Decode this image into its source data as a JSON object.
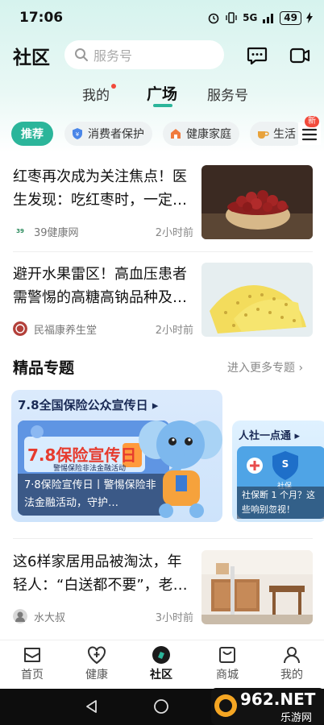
{
  "status_bar": {
    "time": "17:06",
    "signal": "5G",
    "battery": "49"
  },
  "header": {
    "title": "社区",
    "search_placeholder": "服务号"
  },
  "tabs": [
    {
      "label": "我的"
    },
    {
      "label": "广场"
    },
    {
      "label": "服务号"
    }
  ],
  "chips": [
    {
      "label": "推荐"
    },
    {
      "label": "消费者保护"
    },
    {
      "label": "健康家庭"
    },
    {
      "label": "生活"
    }
  ],
  "new_badge": "新",
  "articles": [
    {
      "title": "红枣再次成为关注焦点！医生发现：吃红枣时，一定…",
      "source": "39健康网",
      "time": "2小时前"
    },
    {
      "title": "避开水果雷区！高血压患者需警惕的高糖高钠品种及…",
      "source": "民福康养生堂",
      "time": "2小时前"
    },
    {
      "title": "这6样家居用品被淘汰，年轻人：“白送都不要”，老…",
      "source": "水大叔",
      "time": "3小时前"
    }
  ],
  "topics": {
    "title": "精品专题",
    "more": "进入更多专题",
    "cards": [
      {
        "heading": "7.8全国保险公众宣传日",
        "poster_text": "7.8保险宣传日",
        "poster_sub": "警惕保险非法金融活动",
        "caption": "7·8保险宣传日丨警惕保险非法金融活动，守护…"
      },
      {
        "heading": "人社一点通",
        "badge": "社保",
        "caption": "社保断 1 个月？这些响别忽视！"
      }
    ]
  },
  "bottom_nav": [
    {
      "label": "首页"
    },
    {
      "label": "健康"
    },
    {
      "label": "社区"
    },
    {
      "label": "商城"
    },
    {
      "label": "我的"
    }
  ],
  "watermark": {
    "brand": "962.NET",
    "sub": "乐游网"
  },
  "colors": {
    "accent": "#2bb59a",
    "badge_red": "#f24a3b"
  }
}
